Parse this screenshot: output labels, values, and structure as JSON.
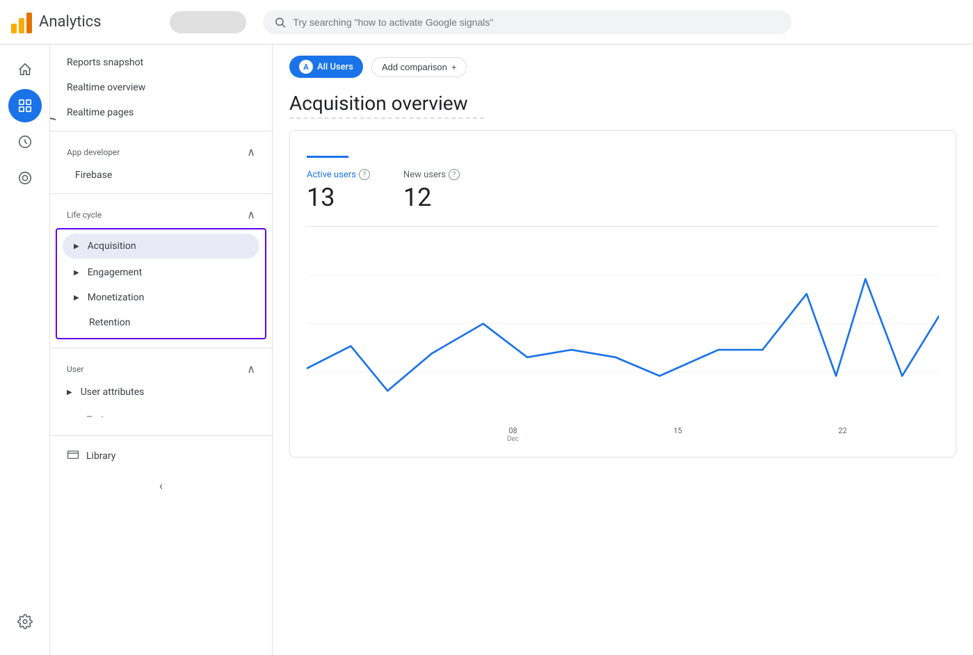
{
  "topbar": {
    "app_name": "Analytics",
    "search_placeholder": "Try searching \"how to activate Google signals\""
  },
  "rail": {
    "icons": [
      {
        "name": "home-icon",
        "symbol": "⌂",
        "active": false
      },
      {
        "name": "reports-icon",
        "symbol": "📊",
        "active": true
      },
      {
        "name": "explore-icon",
        "symbol": "◎",
        "active": false
      },
      {
        "name": "advertising-icon",
        "symbol": "⊙",
        "active": false
      }
    ],
    "settings_icon": {
      "name": "settings-icon",
      "symbol": "⚙"
    }
  },
  "sidebar": {
    "nav_items": [
      {
        "id": "reports-snapshot",
        "label": "Reports snapshot",
        "indent": false
      },
      {
        "id": "realtime-overview",
        "label": "Realtime overview",
        "indent": false
      },
      {
        "id": "realtime-pages",
        "label": "Realtime pages",
        "indent": false
      }
    ],
    "app_developer_section": {
      "label": "App developer",
      "items": [
        {
          "id": "firebase",
          "label": "Firebase"
        }
      ]
    },
    "lifecycle_section": {
      "label": "Life cycle",
      "items": [
        {
          "id": "acquisition",
          "label": "Acquisition",
          "active": true,
          "expandable": true
        },
        {
          "id": "engagement",
          "label": "Engagement",
          "expandable": true
        },
        {
          "id": "monetization",
          "label": "Monetization",
          "expandable": true
        },
        {
          "id": "retention",
          "label": "Retention",
          "expandable": false
        }
      ]
    },
    "user_section": {
      "label": "User",
      "items": [
        {
          "id": "user-attributes",
          "label": "User attributes",
          "expandable": true
        }
      ]
    },
    "library": {
      "label": "Library"
    },
    "collapse_label": "‹"
  },
  "main": {
    "comparison": {
      "all_users_label": "All Users",
      "all_users_avatar": "A",
      "add_comparison_label": "Add comparison",
      "add_icon": "+"
    },
    "page_title": "Acquisition overview",
    "chart_tabs": [
      {
        "id": "tab1",
        "label": "",
        "active": true
      }
    ],
    "metrics": [
      {
        "label": "Active users",
        "value": "13"
      },
      {
        "label": "New users",
        "value": "12"
      }
    ],
    "chart": {
      "x_labels": [
        {
          "date": "08",
          "month": "Dec"
        },
        {
          "date": "15",
          "month": ""
        },
        {
          "date": "22",
          "month": ""
        }
      ],
      "line_color": "#1a73e8"
    }
  }
}
